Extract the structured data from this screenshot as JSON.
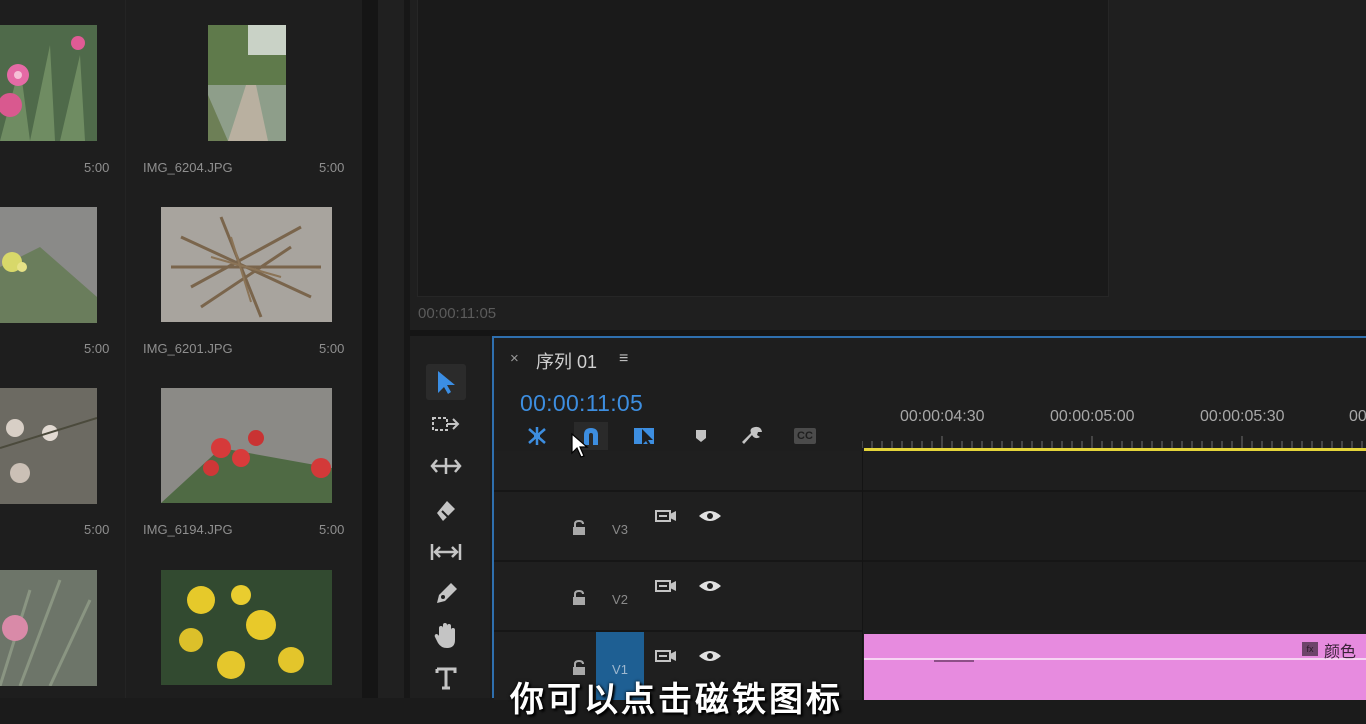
{
  "bin": {
    "tiles": [
      {
        "name": "",
        "duration": "5:00"
      },
      {
        "name": "IMG_6204.JPG",
        "duration": "5:00"
      },
      {
        "name": "",
        "duration": "5:00"
      },
      {
        "name": "IMG_6201.JPG",
        "duration": "5:00"
      },
      {
        "name": "",
        "duration": "5:00"
      },
      {
        "name": "IMG_6194.JPG",
        "duration": "5:00"
      },
      {
        "name": "",
        "duration": ""
      },
      {
        "name": "",
        "duration": ""
      }
    ]
  },
  "monitor": {
    "timecode": "00:00:11:05"
  },
  "timeline": {
    "close": "×",
    "title": "序列 01",
    "menu": "≡",
    "timecode": "00:00:11:05",
    "ruler_labels": [
      "00:00:04:30",
      "00:00:05:00",
      "00:00:05:30",
      "00"
    ],
    "tracks": [
      {
        "name": "V3"
      },
      {
        "name": "V2"
      },
      {
        "name": "V1"
      }
    ],
    "clip_name": "颜色",
    "clip_fx": "fx",
    "cc_label": "CC"
  },
  "subtitle": "你可以点击磁铁图标",
  "colors": {
    "accent_blue": "#3d8ee0",
    "playhead_yellow": "#e4d43a",
    "clip_pink": "#e78bdf"
  }
}
